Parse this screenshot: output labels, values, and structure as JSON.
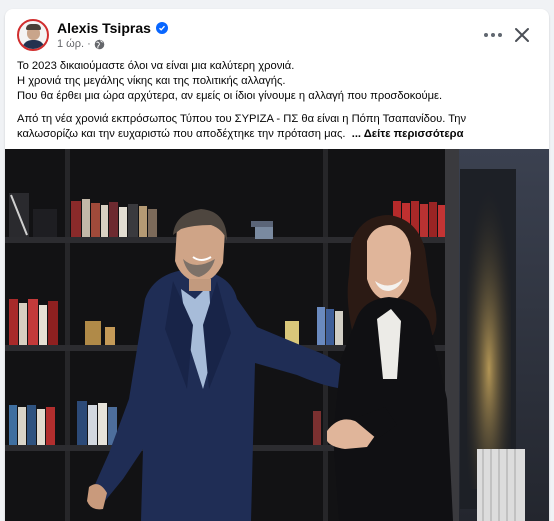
{
  "post": {
    "author": "Alexis Tsipras",
    "time": "1 ώρ. ·",
    "text_lines": [
      "Το 2023 δικαιούμαστε όλοι να είναι μια καλύτερη χρονιά.",
      "Η χρονιά της μεγάλης νίκης και της πολιτικής αλλαγής.",
      "Που θα έρθει μια ώρα αρχύτερα, αν εμείς οι ίδιοι γίνουμε η αλλαγή που προσδοκούμε."
    ],
    "text_lines_2": [
      "Από τη νέα χρονιά εκπρόσωπος Τύπου του ΣΥΡΙΖΑ - ΠΣ θα είναι η Πόπη Τσαπανίδου. Την",
      "καλωσορίζω και την ευχαριστώ που αποδέχτηκε την πρόταση μας."
    ],
    "see_more": "... Δείτε περισσότερα"
  },
  "icons": {
    "verified": "verified-badge-icon",
    "privacy": "globe-icon",
    "more": "more-options-icon",
    "close": "close-icon"
  },
  "colors": {
    "verified": "#0866ff",
    "avatar_ring": "#d12e2e",
    "secondary_text": "#65676b"
  }
}
